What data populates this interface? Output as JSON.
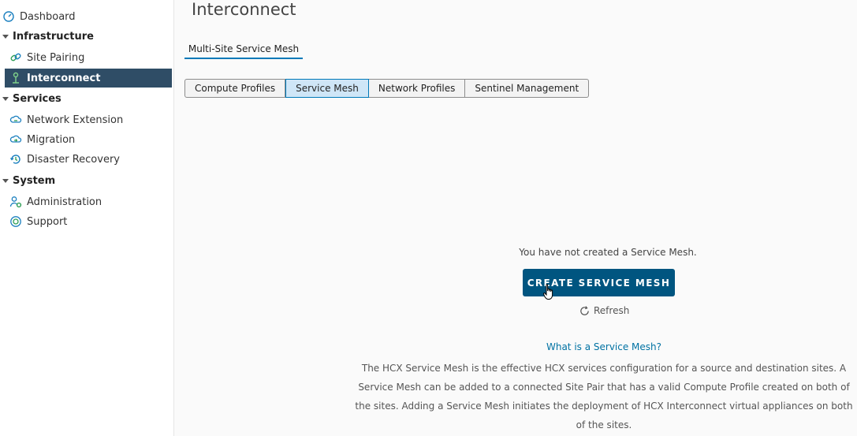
{
  "sidebar": {
    "dashboard": "Dashboard",
    "groups": {
      "infrastructure": "Infrastructure",
      "services": "Services",
      "system": "System"
    },
    "items": {
      "site_pairing": "Site Pairing",
      "interconnect": "Interconnect",
      "network_extension": "Network Extension",
      "migration": "Migration",
      "disaster_recovery": "Disaster Recovery",
      "administration": "Administration",
      "support": "Support"
    }
  },
  "main": {
    "title": "Interconnect",
    "tab": "Multi-Site Service Mesh",
    "segments": {
      "compute_profiles": "Compute Profiles",
      "service_mesh": "Service Mesh",
      "network_profiles": "Network Profiles",
      "sentinel_management": "Sentinel Management"
    },
    "selected_segment": "Service Mesh",
    "empty_message": "You have not created a Service Mesh.",
    "create_button": "CREATE SERVICE MESH",
    "refresh_label": "Refresh",
    "help_title": "What is a Service Mesh?",
    "help_text": "The HCX Service Mesh is the effective HCX services configuration for a source and destination sites. A Service Mesh can be added to a connected Site Pair that has a valid Compute Profile created on both of the sites. Adding a Service Mesh initiates the deployment of HCX Interconnect virtual appliances on both of the sites."
  },
  "colors": {
    "active_nav_bg": "#2f4d66",
    "primary_button": "#005580",
    "link": "#0072a3",
    "tab_underline": "#0079b8"
  }
}
